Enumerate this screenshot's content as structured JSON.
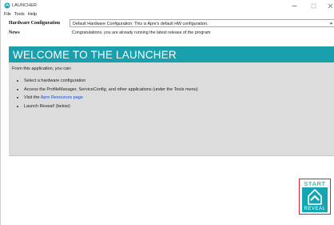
{
  "window": {
    "title": "LAUNCHER",
    "icon": "launcher-app-icon",
    "controls": {
      "minimize": "minimize-icon",
      "maximize": "maximize-icon",
      "close": "close-icon"
    }
  },
  "menu": {
    "items": [
      {
        "label": "File"
      },
      {
        "label": "Tools"
      },
      {
        "label": "Help"
      }
    ]
  },
  "form": {
    "hardware_label": "Hardware Configuration",
    "hardware_value": "Default Hardware Configuration: This is Apre's default HW configuration.",
    "news_label": "News",
    "news_value": "Congratulations, you are already running the latest release of the program"
  },
  "banner": {
    "title": "WELCOME TO THE LAUNCHER",
    "color": "#1a9fad"
  },
  "content": {
    "intro": "From this application, you can:",
    "bullets": {
      "b0": "Select a hardware configuration",
      "b1": "Access the ProfileManager, ServiceConfig, and other applications (under the Tools menu)",
      "b2_prefix": "Visit the ",
      "b2_link": "Apre Resources page",
      "b3": "Launch Reveal! (below)"
    }
  },
  "start_button": {
    "top_label": "START",
    "bottom_label": "REVEAL",
    "icon": "up-arrow-home-icon",
    "accent": "#16a5b2",
    "highlight": "#e0202a"
  }
}
